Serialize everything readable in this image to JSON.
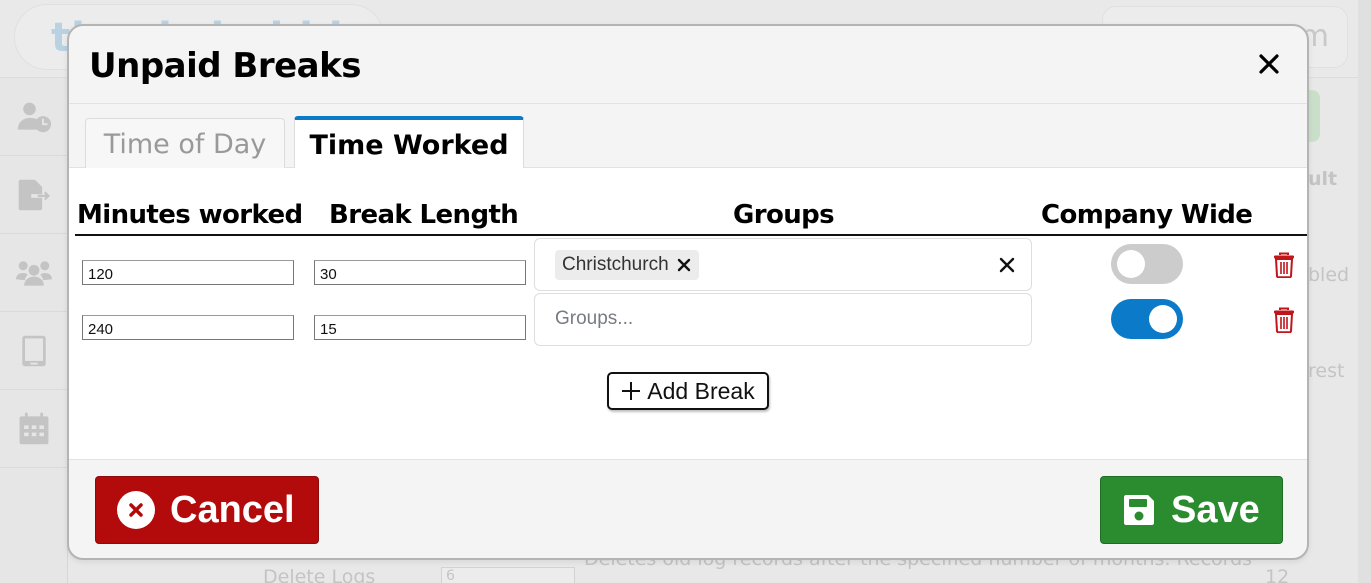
{
  "background": {
    "logo_text": "thanksbubble",
    "search_text": "m",
    "sidebar_icons": [
      "user-clock-icon",
      "file-export-icon",
      "users-icon",
      "tablet-icon",
      "calendar-icon"
    ],
    "right_column": {
      "header_fragment": "ult",
      "row1_fragment": "bled",
      "row2_fragment": "rest"
    },
    "bottom_row": {
      "label": "Delete Logs",
      "input_value": "6",
      "description": "Deletes old log records after the specified number of months. Records",
      "trailing_value": "12"
    }
  },
  "modal": {
    "title": "Unpaid Breaks",
    "close_icon": "close-icon",
    "tabs": [
      {
        "label": "Time of Day",
        "active": false
      },
      {
        "label": "Time Worked",
        "active": true
      }
    ],
    "columns": {
      "minutes_worked": "Minutes worked",
      "break_length": "Break Length",
      "groups": "Groups",
      "company_wide": "Company Wide"
    },
    "rows": [
      {
        "minutes_worked": "120",
        "break_length": "30",
        "groups": [
          "Christchurch"
        ],
        "groups_placeholder": "",
        "company_wide": false
      },
      {
        "minutes_worked": "240",
        "break_length": "15",
        "groups": [],
        "groups_placeholder": "Groups...",
        "company_wide": true
      }
    ],
    "add_break_label": "Add Break",
    "cancel_label": "Cancel",
    "save_label": "Save"
  },
  "colors": {
    "accent_blue": "#0a7ac9",
    "cancel_red": "#b30b0b",
    "save_green": "#2b8b2f",
    "trash_red": "#c0161b",
    "toggle_off": "#cccccc"
  }
}
